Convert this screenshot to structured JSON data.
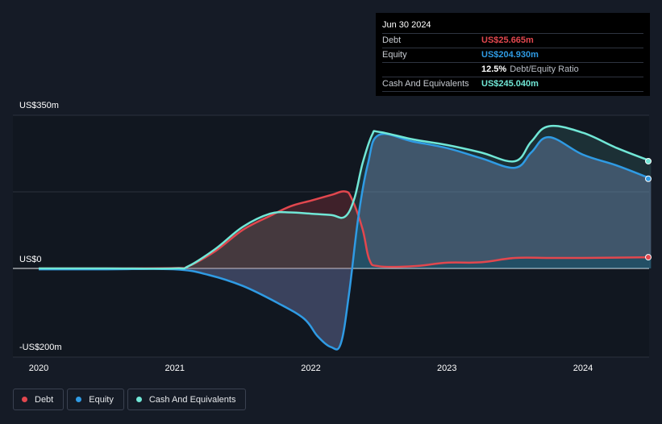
{
  "tooltip": {
    "date": "Jun 30 2024",
    "debt_label": "Debt",
    "debt_value": "US$25.665m",
    "equity_label": "Equity",
    "equity_value": "US$204.930m",
    "ratio_value": "12.5%",
    "ratio_label": "Debt/Equity Ratio",
    "cash_label": "Cash And Equivalents",
    "cash_value": "US$245.040m"
  },
  "legend": [
    {
      "label": "Debt",
      "color": "#e2474e",
      "icon": "debt-dot-icon"
    },
    {
      "label": "Equity",
      "color": "#2f9be4",
      "icon": "equity-dot-icon"
    },
    {
      "label": "Cash And Equivalents",
      "color": "#71e7d6",
      "icon": "cash-dot-icon"
    }
  ],
  "colors": {
    "debt": "#e2474e",
    "equity": "#2f9be4",
    "cash": "#71e7d6",
    "background": "#151b26",
    "plot_background": "#111720"
  },
  "chart_data": {
    "type": "line",
    "y_tick_labels": [
      {
        "value": 350,
        "label": "US$350m"
      },
      {
        "value": 0,
        "label": "US$0"
      },
      {
        "value": -200,
        "label": "-US$200m"
      }
    ],
    "ylim": [
      -200,
      350
    ],
    "x_tick_labels": [
      {
        "value": 2020.0,
        "label": "2020"
      },
      {
        "value": 2021.0,
        "label": "2021"
      },
      {
        "value": 2022.0,
        "label": "2022"
      },
      {
        "value": 2023.0,
        "label": "2023"
      },
      {
        "value": 2024.0,
        "label": "2024"
      }
    ],
    "xlim": [
      2019.8,
      2024.5
    ],
    "series": [
      {
        "name": "Debt",
        "color": "#e2474e",
        "points": [
          [
            2020.0,
            0
          ],
          [
            2020.5,
            0
          ],
          [
            2021.0,
            1
          ],
          [
            2021.1,
            5
          ],
          [
            2021.3,
            40
          ],
          [
            2021.5,
            88
          ],
          [
            2021.7,
            120
          ],
          [
            2021.85,
            142
          ],
          [
            2022.0,
            155
          ],
          [
            2022.15,
            168
          ],
          [
            2022.25,
            176
          ],
          [
            2022.3,
            160
          ],
          [
            2022.38,
            90
          ],
          [
            2022.43,
            20
          ],
          [
            2022.5,
            5
          ],
          [
            2022.75,
            5
          ],
          [
            2023.0,
            13
          ],
          [
            2023.25,
            14
          ],
          [
            2023.5,
            24
          ],
          [
            2023.75,
            24
          ],
          [
            2024.0,
            24
          ],
          [
            2024.5,
            25.665
          ]
        ]
      },
      {
        "name": "Equity",
        "color": "#2f9be4",
        "points": [
          [
            2020.0,
            -2
          ],
          [
            2020.5,
            -2
          ],
          [
            2021.0,
            -2
          ],
          [
            2021.25,
            -15
          ],
          [
            2021.5,
            -40
          ],
          [
            2021.75,
            -78
          ],
          [
            2021.95,
            -115
          ],
          [
            2022.05,
            -155
          ],
          [
            2022.15,
            -180
          ],
          [
            2022.22,
            -172
          ],
          [
            2022.28,
            -60
          ],
          [
            2022.35,
            120
          ],
          [
            2022.42,
            240
          ],
          [
            2022.5,
            305
          ],
          [
            2022.75,
            290
          ],
          [
            2023.0,
            275
          ],
          [
            2023.25,
            252
          ],
          [
            2023.5,
            230
          ],
          [
            2023.62,
            265
          ],
          [
            2023.75,
            300
          ],
          [
            2024.0,
            260
          ],
          [
            2024.25,
            235
          ],
          [
            2024.5,
            204.93
          ]
        ]
      },
      {
        "name": "Cash And Equivalents",
        "color": "#71e7d6",
        "points": [
          [
            2020.0,
            0
          ],
          [
            2020.5,
            0
          ],
          [
            2021.0,
            0
          ],
          [
            2021.1,
            5
          ],
          [
            2021.3,
            45
          ],
          [
            2021.5,
            95
          ],
          [
            2021.7,
            125
          ],
          [
            2021.85,
            128
          ],
          [
            2022.0,
            125
          ],
          [
            2022.15,
            122
          ],
          [
            2022.25,
            118
          ],
          [
            2022.32,
            160
          ],
          [
            2022.38,
            240
          ],
          [
            2022.45,
            305
          ],
          [
            2022.5,
            312
          ],
          [
            2022.75,
            295
          ],
          [
            2023.0,
            282
          ],
          [
            2023.25,
            265
          ],
          [
            2023.5,
            245
          ],
          [
            2023.62,
            290
          ],
          [
            2023.75,
            325
          ],
          [
            2024.0,
            310
          ],
          [
            2024.25,
            275
          ],
          [
            2024.5,
            245.04
          ]
        ]
      }
    ]
  }
}
